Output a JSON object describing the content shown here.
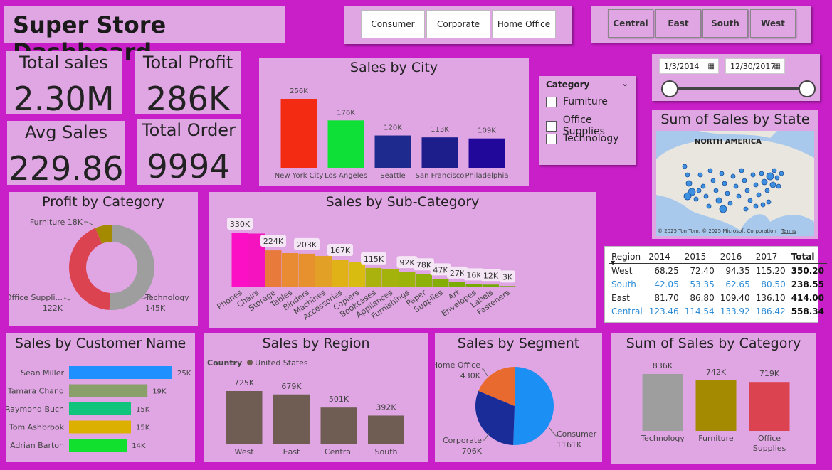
{
  "title": "Super Store Dashboard",
  "segments": [
    "Consumer",
    "Corporate",
    "Home Office"
  ],
  "regions": [
    "Central",
    "East",
    "South",
    "West"
  ],
  "kpis": [
    {
      "label": "Total sales",
      "value": "2.30M"
    },
    {
      "label": "Total Profit",
      "value": "286K"
    },
    {
      "label": "Avg Sales",
      "value": "229.86"
    },
    {
      "label": "Total Order",
      "value": "9994"
    }
  ],
  "category_slicer": {
    "header": "Category",
    "options": [
      "Furniture",
      "Office Supplies",
      "Technology"
    ]
  },
  "date_range": {
    "start": "1/3/2014",
    "end": "12/30/2017"
  },
  "map": {
    "title": "Sum of Sales by State",
    "label": "NORTH AMERICA",
    "credit": "© 2025 TomTom, © 2025 Microsoft Corporation",
    "terms": "Terms"
  },
  "matrix": {
    "headers": [
      "Region",
      "2014",
      "2015",
      "2016",
      "2017",
      "Total"
    ],
    "rows": [
      {
        "region": "West",
        "values": [
          "68.25",
          "72.40",
          "94.35",
          "115.20"
        ],
        "total": "350.20",
        "color": "#222222"
      },
      {
        "region": "South",
        "values": [
          "42.05",
          "53.35",
          "62.65",
          "80.50"
        ],
        "total": "238.55",
        "color": "#2b8bd6"
      },
      {
        "region": "East",
        "values": [
          "81.70",
          "86.80",
          "109.40",
          "136.10"
        ],
        "total": "414.00",
        "color": "#222222"
      },
      {
        "region": "Central",
        "values": [
          "123.46",
          "114.54",
          "133.92",
          "186.42"
        ],
        "total": "558.34",
        "color": "#2b8bd6"
      }
    ]
  },
  "chart_data": [
    {
      "id": "city",
      "type": "bar",
      "title": "Sales by City",
      "categories": [
        "New York City",
        "Los Angeles",
        "Seattle",
        "San Francisco",
        "Philadelphia"
      ],
      "values": [
        256,
        176,
        120,
        113,
        109
      ],
      "labels": [
        "256K",
        "176K",
        "120K",
        "113K",
        "109K"
      ],
      "colors": [
        "#f22b12",
        "#0fe038",
        "#1f2a8e",
        "#1d1d8c",
        "#21079a"
      ],
      "unit": "K"
    },
    {
      "id": "profit_category",
      "type": "pie",
      "donut": true,
      "title": "Profit by Category",
      "categories": [
        "Technology",
        "Office Supplies",
        "Furniture"
      ],
      "values": [
        145,
        122,
        18
      ],
      "labels": [
        "Technology 145K",
        "Office Suppli... 122K",
        "Furniture 18K"
      ],
      "colors": [
        "#9e9e9e",
        "#dc4350",
        "#a48a00"
      ]
    },
    {
      "id": "subcategory",
      "type": "bar",
      "title": "Sales by Sub-Category",
      "categories": [
        "Phones",
        "Chairs",
        "Storage",
        "Tables",
        "Binders",
        "Machines",
        "Accessories",
        "Copiers",
        "Bookcases",
        "Appliances",
        "Furnishings",
        "Paper",
        "Supplies",
        "Art",
        "Envelopes",
        "Labels",
        "Fasteners"
      ],
      "values": [
        330,
        328,
        224,
        207,
        203,
        189,
        167,
        150,
        115,
        108,
        92,
        78,
        47,
        27,
        16,
        12,
        3
      ],
      "labels": [
        "330K",
        "",
        "224K",
        "",
        "203K",
        "",
        "167K",
        "",
        "115K",
        "",
        "92K",
        "78K",
        "47K",
        "27K",
        "16K",
        "12K",
        "3K"
      ],
      "colors": [
        "#fb10c6",
        "#f513c0",
        "#e87a3c",
        "#e88b33",
        "#e6912e",
        "#e3a027",
        "#e0b218",
        "#d9bc10",
        "#aab30e",
        "#a3b30c",
        "#9cb40a",
        "#8eb108",
        "#84ae05",
        "#7bac04",
        "#76aa03",
        "#72a902",
        "#6aa700"
      ]
    },
    {
      "id": "customer",
      "type": "bar",
      "orientation": "horizontal",
      "title": "Sales by Customer Name",
      "categories": [
        "Sean Miller",
        "Tamara Chand",
        "Raymond Buch",
        "Tom Ashbrook",
        "Adrian Barton"
      ],
      "values": [
        25,
        19,
        15,
        15,
        14
      ],
      "labels": [
        "25K",
        "19K",
        "15K",
        "15K",
        "14K"
      ],
      "colors": [
        "#1e90ff",
        "#8aa06b",
        "#10c47c",
        "#dcb000",
        "#12e02e"
      ]
    },
    {
      "id": "region",
      "type": "bar",
      "title": "Sales by Region",
      "legend_title": "Country",
      "series_name": "United States",
      "categories": [
        "West",
        "East",
        "Central",
        "South"
      ],
      "values": [
        725,
        679,
        501,
        392
      ],
      "labels": [
        "725K",
        "679K",
        "501K",
        "392K"
      ],
      "color": "#6f5d54"
    },
    {
      "id": "segment",
      "type": "pie",
      "title": "Sales by Segment",
      "categories": [
        "Consumer",
        "Corporate",
        "Home Office"
      ],
      "values": [
        1161,
        706,
        430
      ],
      "labels": [
        "Consumer 1161K",
        "Corporate 706K",
        "Home Office 430K"
      ],
      "colors": [
        "#1c8ff5",
        "#1a2c98",
        "#e86a2f"
      ]
    },
    {
      "id": "category_sum",
      "type": "bar",
      "title": "Sum of Sales by Category",
      "categories": [
        "Technology",
        "Furniture",
        "Office Supplies"
      ],
      "values": [
        836,
        742,
        719
      ],
      "labels": [
        "836K",
        "742K",
        "719K"
      ],
      "colors": [
        "#9e9e9e",
        "#a48a00",
        "#dc4350"
      ]
    }
  ]
}
